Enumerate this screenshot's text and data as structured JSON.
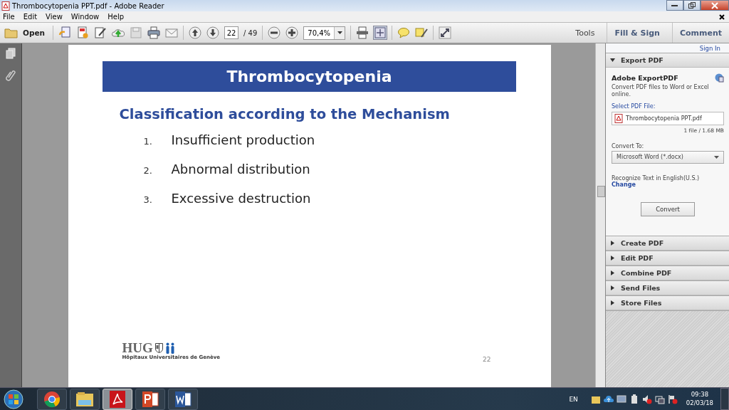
{
  "window": {
    "title": "Thrombocytopenia PPT.pdf - Adobe Reader"
  },
  "menu": [
    "File",
    "Edit",
    "View",
    "Window",
    "Help"
  ],
  "toolbar": {
    "open_label": "Open",
    "page": "22",
    "page_count": "/ 49",
    "zoom": "70,4%",
    "tabs": [
      {
        "label": "Tools",
        "selected": false
      },
      {
        "label": "Fill & Sign",
        "selected": false
      },
      {
        "label": "Comment",
        "selected": false
      }
    ]
  },
  "slide": {
    "title": "Thrombocytopenia",
    "subtitle": "Classification according to the Mechanism",
    "items": [
      {
        "number": "1.",
        "text": "Insufficient production"
      },
      {
        "number": "2.",
        "text": "Abnormal distribution"
      },
      {
        "number": "3.",
        "text": "Excessive destruction"
      }
    ],
    "logo_text": "HUG",
    "logo_caption": "Hôpitaux Universitaires de Genève",
    "page_number": "22"
  },
  "pane": {
    "sign_in": "Sign In",
    "sections": [
      {
        "label": "Export PDF",
        "expanded": true
      },
      {
        "label": "Create PDF",
        "expanded": false
      },
      {
        "label": "Edit PDF",
        "expanded": false
      },
      {
        "label": "Combine PDF",
        "expanded": false
      },
      {
        "label": "Send Files",
        "expanded": false
      },
      {
        "label": "Store Files",
        "expanded": false
      }
    ],
    "export": {
      "heading": "Adobe ExportPDF",
      "description": "Convert PDF files to Word or Excel online.",
      "select_label": "Select PDF File:",
      "file_name": "Thrombocytopenia PPT.pdf",
      "file_info": "1 file / 1.68 MB",
      "convert_label": "Convert To:",
      "format": "Microsoft Word (*.docx)",
      "recognize": "Recognize Text in English(U.S.)",
      "change_link": "Change",
      "button": "Convert"
    }
  },
  "taskbar": {
    "apps": [
      {
        "kind": "chrome",
        "selected": false
      },
      {
        "kind": "explorer",
        "selected": false
      },
      {
        "kind": "acrobat",
        "selected": true
      },
      {
        "kind": "powerpoint",
        "selected": false
      },
      {
        "kind": "word",
        "selected": false
      }
    ],
    "language": "EN",
    "time": "09:38",
    "date": "02/03/18"
  }
}
